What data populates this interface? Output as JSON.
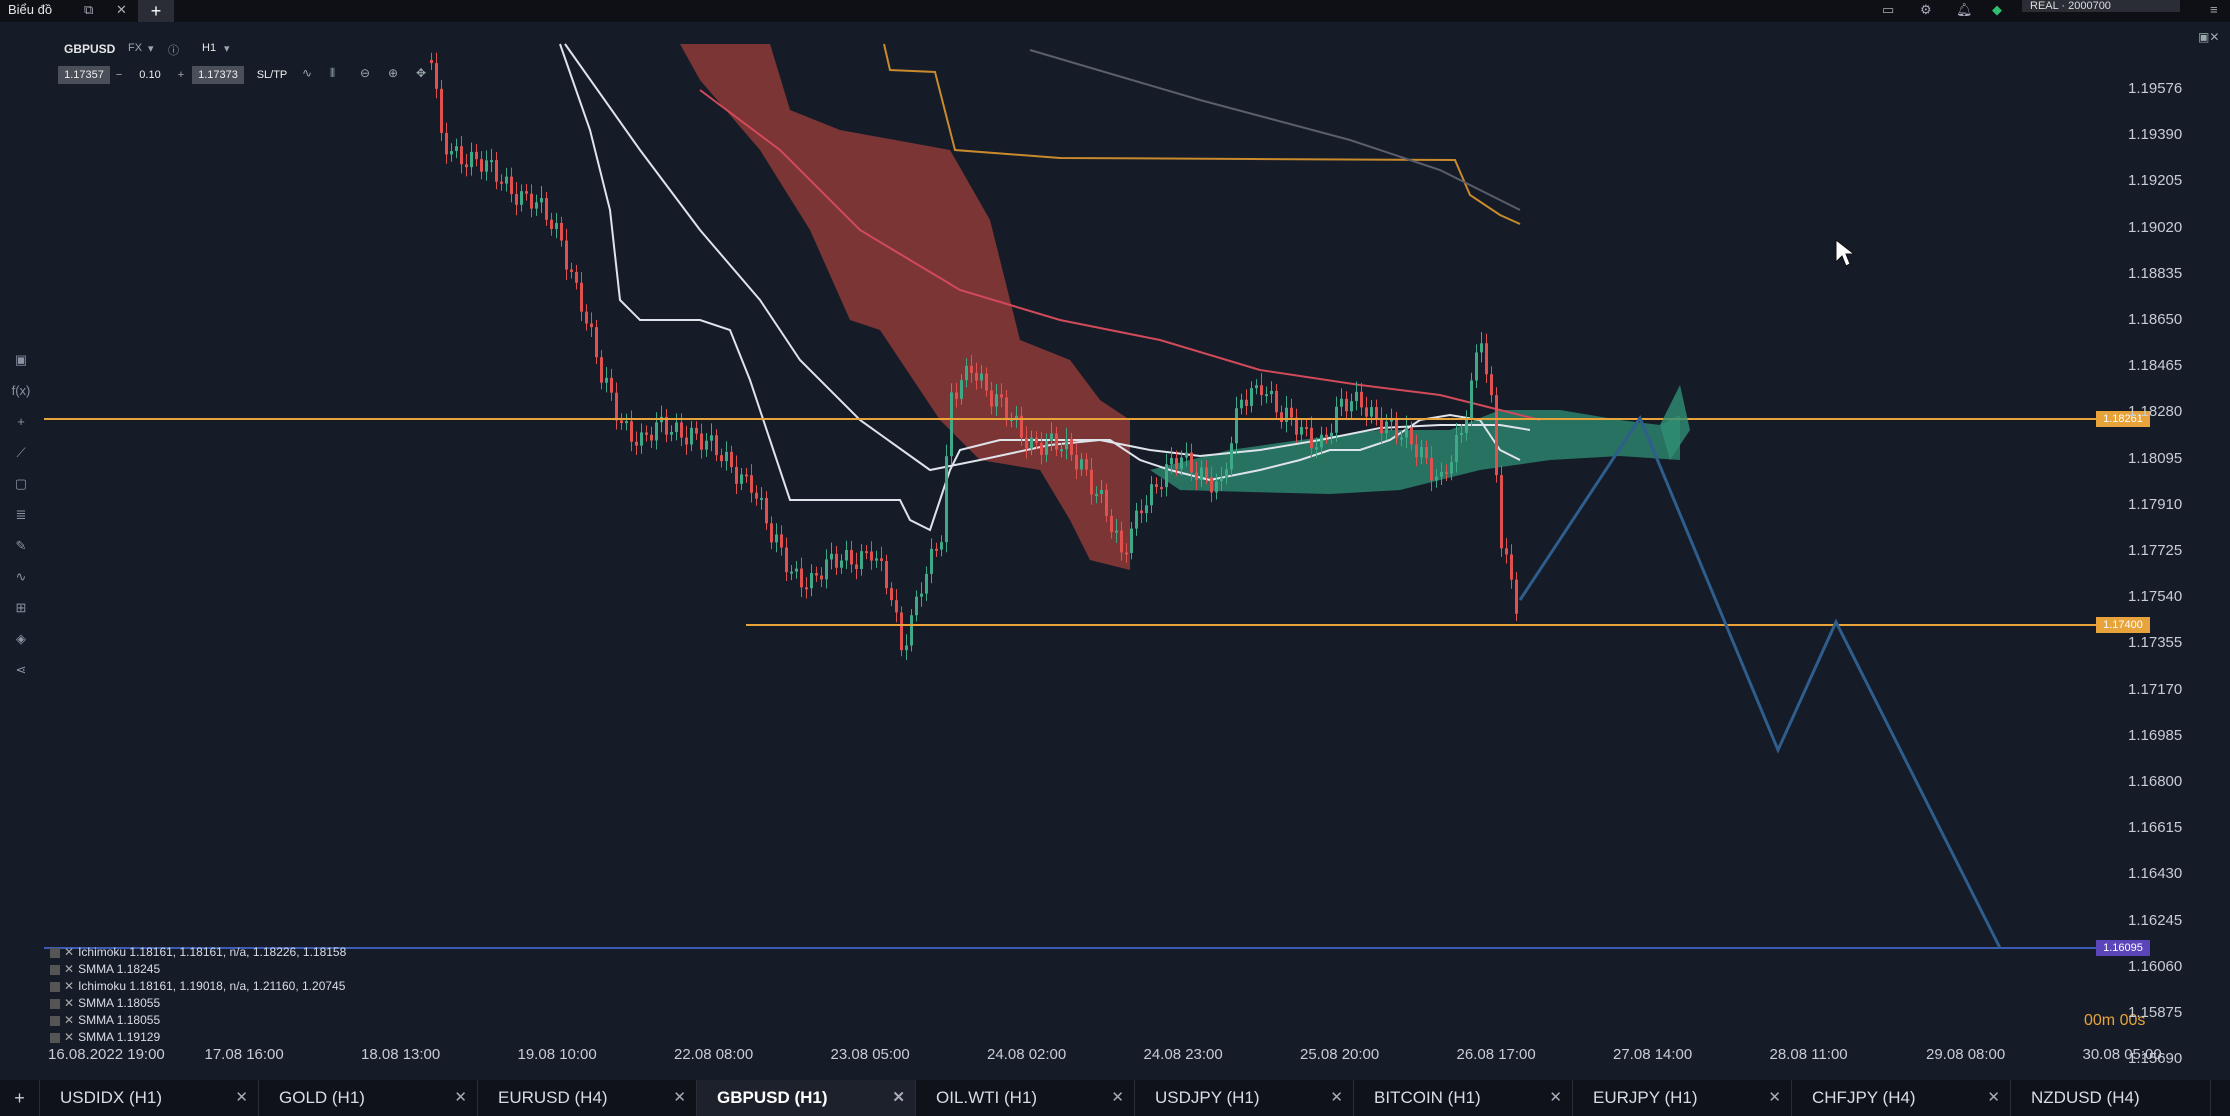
{
  "window": {
    "title": "Biểu đồ",
    "account_label": "REAL · 2000700"
  },
  "chart_header": {
    "symbol": "GBPUSD",
    "market": "FX",
    "timeframe": "H1",
    "bid": "1.17357",
    "lot": "0.10",
    "ask": "1.17373",
    "sltp_label": "SL/TP"
  },
  "price_axis": [
    "1.19576",
    "1.19390",
    "1.19205",
    "1.19020",
    "1.18835",
    "1.18650",
    "1.18465",
    "1.18280",
    "1.18095",
    "1.17910",
    "1.17725",
    "1.17540",
    "1.17355",
    "1.17170",
    "1.16985",
    "1.16800",
    "1.16615",
    "1.16430",
    "1.16245",
    "1.16060",
    "1.15875",
    "1.15690"
  ],
  "time_axis": [
    "16.08.2022 19:00",
    "17.08 16:00",
    "18.08 13:00",
    "19.08 10:00",
    "22.08 08:00",
    "23.08 05:00",
    "24.08 02:00",
    "24.08 23:00",
    "25.08 20:00",
    "26.08 17:00",
    "27.08 14:00",
    "28.08 11:00",
    "29.08 08:00",
    "30.08 05:00"
  ],
  "price_tags": {
    "upper_line": "1.18261",
    "lower_line": "1.17400",
    "target_line": "1.16095"
  },
  "indicators": [
    "Ichimoku 1.18161, 1.18161, n/a, 1.18226, 1.18158",
    "SMMA 1.18245",
    "Ichimoku 1.18161, 1.19018, n/a, 1.21160, 1.20745",
    "SMMA 1.18055",
    "SMMA 1.18055",
    "SMMA 1.19129"
  ],
  "countdown": "00m 00s",
  "tabs": [
    {
      "label": "USDIDX (H1)",
      "active": false
    },
    {
      "label": "GOLD (H1)",
      "active": false
    },
    {
      "label": "EURUSD (H4)",
      "active": false
    },
    {
      "label": "GBPUSD (H1)",
      "active": true
    },
    {
      "label": "OIL.WTI (H1)",
      "active": false
    },
    {
      "label": "USDJPY (H1)",
      "active": false
    },
    {
      "label": "BITCOIN (H1)",
      "active": false
    },
    {
      "label": "EURJPY (H1)",
      "active": false
    },
    {
      "label": "CHFJPY (H4)",
      "active": false
    },
    {
      "label": "NZDUSD (H4)",
      "active": false
    }
  ],
  "colors": {
    "background": "#151c28",
    "bull": "#3fa886",
    "bear": "#e0504f",
    "level_line": "#e8a33a",
    "target_line": "#3e5bb3",
    "forecast_path": "#2f5d8c"
  }
}
